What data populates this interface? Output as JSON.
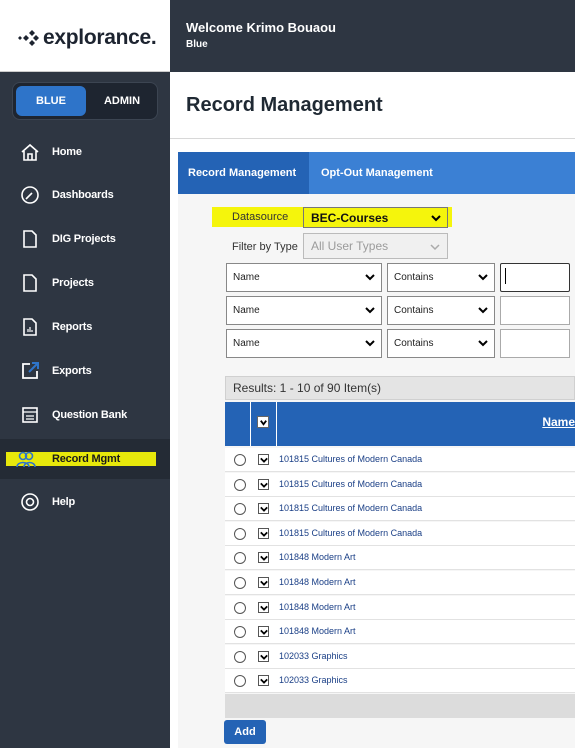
{
  "brand": {
    "logo_text": "explorance."
  },
  "header": {
    "welcome": "Welcome Krimo Bouaou",
    "subtitle": "Blue"
  },
  "sidebar": {
    "toggle": {
      "left": "BLUE",
      "right": "ADMIN"
    },
    "items": [
      {
        "label": "Home",
        "icon": "home-icon"
      },
      {
        "label": "Dashboards",
        "icon": "gauge-icon"
      },
      {
        "label": "DIG Projects",
        "icon": "document-icon"
      },
      {
        "label": "Projects",
        "icon": "document-icon"
      },
      {
        "label": "Reports",
        "icon": "report-icon"
      },
      {
        "label": "Exports",
        "icon": "export-icon"
      },
      {
        "label": "Question Bank",
        "icon": "database-icon"
      },
      {
        "label": "Record Mgmt",
        "icon": "users-icon",
        "active": true
      },
      {
        "label": "Help",
        "icon": "help-icon"
      }
    ]
  },
  "page": {
    "title": "Record Management"
  },
  "tabs": [
    {
      "label": "Record Management",
      "active": true
    },
    {
      "label": "Opt-Out Management"
    }
  ],
  "filters": {
    "datasource_label": "Datasource",
    "datasource_value": "BEC-Courses",
    "type_label": "Filter by Type",
    "type_value": "All User Types",
    "rows": [
      {
        "field": "Name",
        "operator": "Contains",
        "value": ""
      },
      {
        "field": "Name",
        "operator": "Contains",
        "value": ""
      },
      {
        "field": "Name",
        "operator": "Contains",
        "value": ""
      }
    ]
  },
  "results": {
    "summary": "Results: 1 - 10 of 90 Item(s)",
    "column_name": "Name",
    "rows": [
      "101815 Cultures of Modern Canada",
      "101815 Cultures of Modern Canada",
      "101815 Cultures of Modern Canada",
      "101815 Cultures of Modern Canada",
      "101848 Modern Art",
      "101848 Modern Art",
      "101848 Modern Art",
      "101848 Modern Art",
      "102033 Graphics",
      "102033 Graphics"
    ]
  },
  "actions": {
    "add_label": "Add"
  },
  "colors": {
    "sidebar": "#2e3642",
    "accent": "#2463b5",
    "tab_bar": "#3b80d4",
    "highlight": "#f5f50c"
  }
}
